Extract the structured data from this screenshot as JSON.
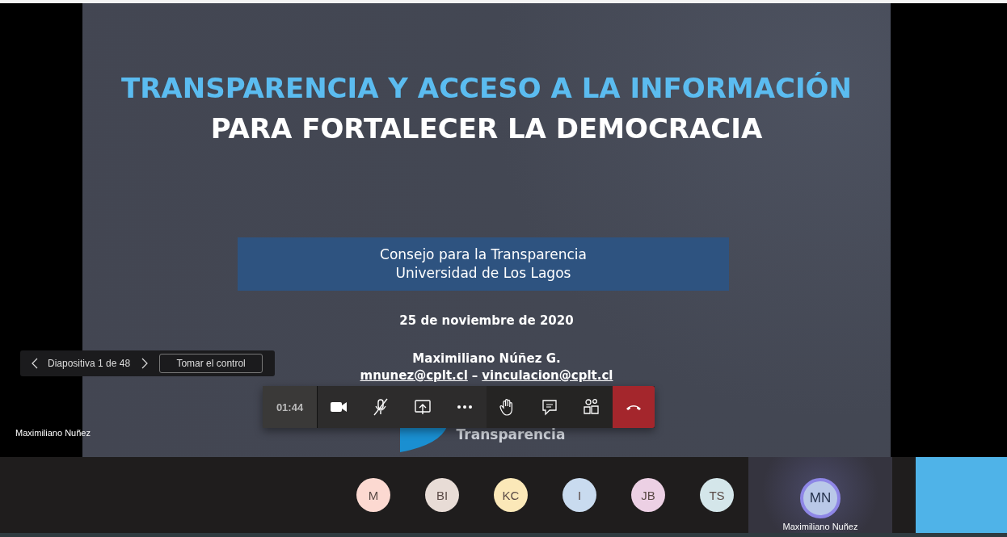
{
  "slide": {
    "title_lines": [
      {
        "text": "TRANSPARENCIA Y ACCESO A LA INFORMACIÓN",
        "color": "#5bbcf0"
      },
      {
        "text": "PARA FORTALECER LA DEMOCRACIA",
        "color": "#ffffff"
      }
    ],
    "banner_lines": [
      "Consejo para la Transparencia",
      "Universidad de Los Lagos"
    ],
    "date": "25 de noviembre de 2020",
    "presenter": "Maximiliano Núñez G.",
    "emails": [
      "mnunez@cplt.cl",
      "vinculacion@cplt.cl"
    ],
    "email_separator": "–",
    "logo_text": "Transparencia"
  },
  "slide_controls": {
    "position": "Diapositiva 1 de 48",
    "take_control": "Tomar el control"
  },
  "presenter_label": "Maximiliano Nuñez",
  "toolbar": {
    "timer": "01:44",
    "buttons": [
      {
        "kind": "camera"
      },
      {
        "kind": "mic",
        "muted": true
      },
      {
        "kind": "share"
      },
      {
        "kind": "more"
      },
      {
        "kind": "hand"
      },
      {
        "kind": "chat"
      },
      {
        "kind": "people"
      },
      {
        "kind": "hangup"
      }
    ]
  },
  "participants": [
    {
      "initials": "M",
      "color": "#fcd9d1"
    },
    {
      "initials": "BI",
      "color": "#e8dcd6"
    },
    {
      "initials": "KC",
      "color": "#fbe8b8"
    },
    {
      "initials": "I",
      "color": "#c9dbef"
    },
    {
      "initials": "JB",
      "color": "#ecd0e4"
    },
    {
      "initials": "TS",
      "color": "#d4e6ea"
    }
  ],
  "self_tile": {
    "initials": "MN",
    "name": "Maximiliano Nuñez"
  }
}
